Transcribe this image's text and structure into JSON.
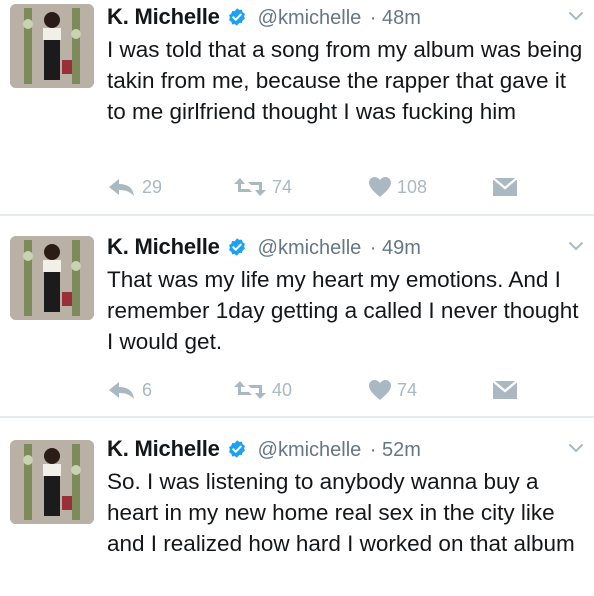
{
  "tweets": [
    {
      "name": "K. Michelle",
      "handle": "@kmichelle",
      "time": "· 48m",
      "text": "I was told that a song from my album was being takin from me, because the rapper that gave it to me girlfriend thought I was fucking him",
      "replies": "29",
      "retweets": "74",
      "likes": "108"
    },
    {
      "name": "K. Michelle",
      "handle": "@kmichelle",
      "time": "· 49m",
      "text": "That was my life my heart my emotions. And I remember 1day getting a called I never thought I would get.",
      "replies": "6",
      "retweets": "40",
      "likes": "74"
    },
    {
      "name": "K. Michelle",
      "handle": "@kmichelle",
      "time": "· 52m",
      "text": "So. I was listening to anybody wanna buy a heart in my new home real sex in the city like and I realized how hard I worked on that album",
      "replies": "",
      "retweets": "",
      "likes": ""
    }
  ],
  "icons": {
    "verified": "verified-badge-icon",
    "caret": "chevron-down-icon",
    "reply": "reply-icon",
    "retweet": "retweet-icon",
    "like": "heart-icon",
    "message": "direct-message-icon"
  },
  "colors": {
    "text": "#14171a",
    "secondary": "#657786",
    "action": "#aab8c2",
    "verified": "#1da1f2",
    "divider": "#e6ecf0"
  }
}
